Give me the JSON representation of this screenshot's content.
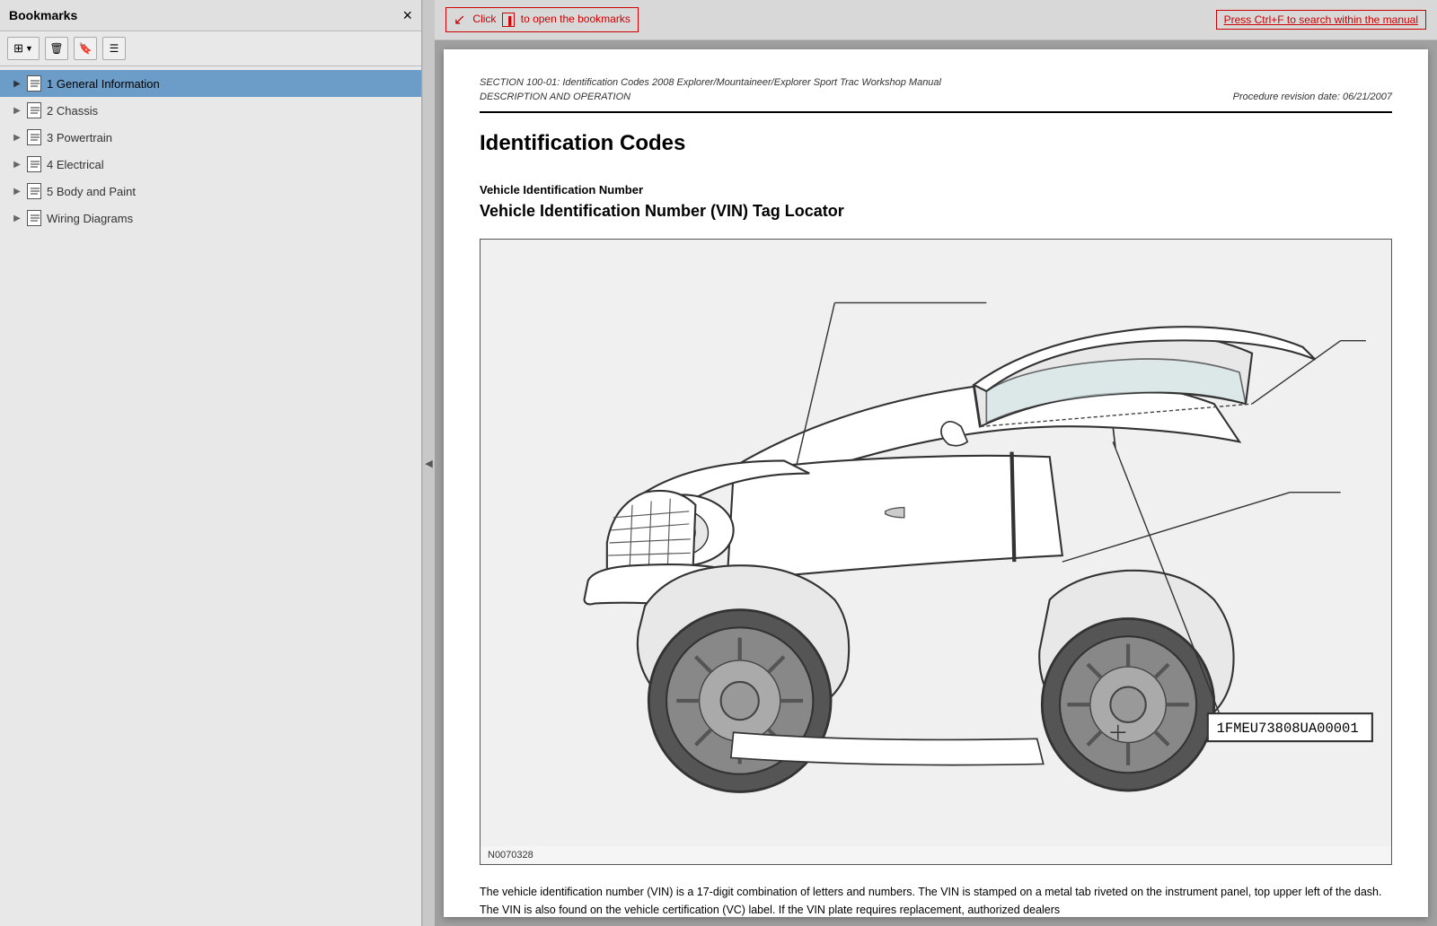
{
  "sidebar": {
    "title": "Bookmarks",
    "close_label": "×",
    "toolbar": {
      "dropdown_label": "▼",
      "delete_label": "🗑",
      "save_label": "🔖",
      "expand_label": "⊞"
    },
    "items": [
      {
        "id": 1,
        "label": "1 General Information",
        "active": true,
        "indent": 0
      },
      {
        "id": 2,
        "label": "2 Chassis",
        "active": false,
        "indent": 0
      },
      {
        "id": 3,
        "label": "3 Powertrain",
        "active": false,
        "indent": 0
      },
      {
        "id": 4,
        "label": "4 Electrical",
        "active": false,
        "indent": 0
      },
      {
        "id": 5,
        "label": "5 Body and Paint",
        "active": false,
        "indent": 0
      },
      {
        "id": 6,
        "label": "Wiring Diagrams",
        "active": false,
        "indent": 0
      }
    ]
  },
  "topbar": {
    "hint_left": "Click  to open the bookmarks",
    "hint_right": "Press Ctrl+F to search within the manual",
    "bookmark_icon_hint": "bookmarks panel icon"
  },
  "document": {
    "section_header": "SECTION 100-01: Identification Codes  2008 Explorer/Mountaineer/Explorer Sport Trac Workshop Manual",
    "section_subheader": "DESCRIPTION AND OPERATION",
    "procedure_date": "Procedure revision date: 06/21/2007",
    "main_title": "Identification Codes",
    "vin_label": "Vehicle Identification Number",
    "vin_section_title": "Vehicle Identification Number (VIN) Tag Locator",
    "diagram_figure_label": "N0070328",
    "vin_sample": "1FMEU73808UA00001",
    "body_text": "The vehicle identification number (VIN) is a 17-digit combination of letters and numbers. The VIN is stamped on a metal tab riveted on the instrument panel, top upper left of the dash. The VIN is also found on the vehicle certification (VC) label. If the VIN plate requires replacement, authorized dealers"
  },
  "collapse_handle": {
    "label": "◀"
  }
}
